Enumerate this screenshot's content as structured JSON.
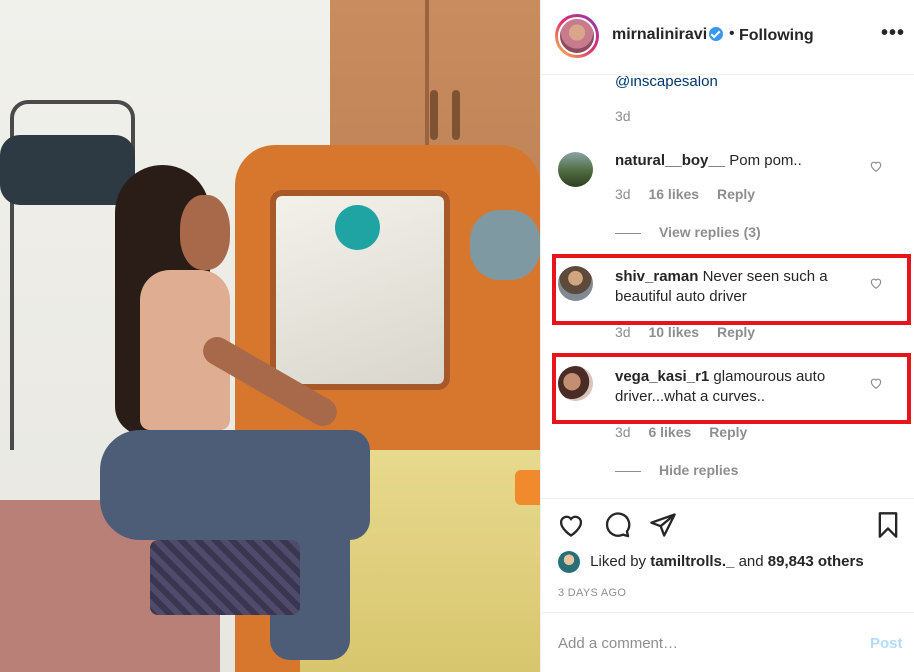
{
  "post": {
    "username": "mirnaliniravi",
    "separator": "•",
    "follow_status": "Following",
    "more_label": "•••"
  },
  "caption_tail": {
    "mention": "@inscapesalon",
    "time": "3d"
  },
  "comments": [
    {
      "username": "natural__boy__",
      "text": "Pom pom..",
      "time": "3d",
      "likes": "16 likes",
      "reply": "Reply"
    },
    {
      "username": "shiv_raman",
      "text": "Never seen such a beautiful auto driver",
      "time": "3d",
      "likes": "10 likes",
      "reply": "Reply"
    },
    {
      "username": "vega_kasi_r1",
      "text": "glamourous auto driver...what a curves..",
      "time": "3d",
      "likes": "6 likes",
      "reply": "Reply"
    }
  ],
  "replies": {
    "view": "View replies (3)",
    "hide": "Hide replies"
  },
  "liked_by": {
    "prefix": "Liked by",
    "user": "tamiltrolls._",
    "middle": "and",
    "count": "89,843 others"
  },
  "time_ago": "3 DAYS AGO",
  "add_comment": {
    "placeholder": "Add a comment…",
    "post_label": "Post"
  },
  "colors": {
    "highlight_box": "#e8141c",
    "link": "#00376b",
    "muted": "#8e8e8e",
    "post_disabled": "#b3dbff",
    "verified": "#3897f0"
  }
}
